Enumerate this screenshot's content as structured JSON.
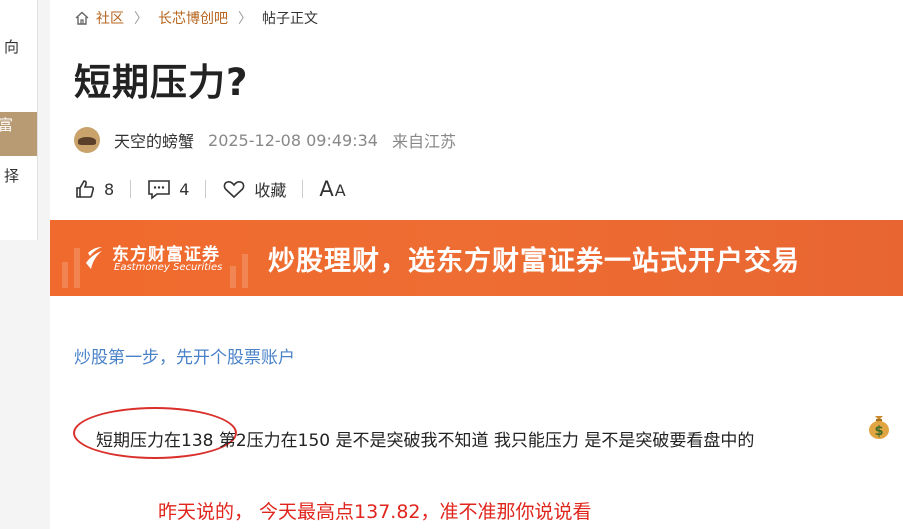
{
  "left_panel": {
    "line1": "向",
    "band": "富",
    "line2": "择"
  },
  "breadcrumb": {
    "home": "社区",
    "forum": "长芯博创吧",
    "current": "帖子正文",
    "separator": "〉"
  },
  "post": {
    "title": "短期压力?",
    "author": "天空的螃蟹",
    "time": "2025-12-08 09:49:34",
    "from": "来自江苏"
  },
  "actions": {
    "likes": "8",
    "comments": "4",
    "favorite_label": "收藏",
    "font_label_big": "A",
    "font_label_small": "A"
  },
  "banner": {
    "brand_cn": "东方财富证券",
    "brand_en": "Eastmoney Securities",
    "slogan": "炒股理财，选东方财富证券一站式开户交易"
  },
  "content": {
    "promo_link": "炒股第一步，先开个股票账户",
    "body": "短期压力在138 第2压力在150 是不是突破我不知道 我只能压力 是不是突破要看盘中的",
    "red_text": "昨天说的， 今天最高点137.82，准不准那你说说看"
  },
  "colors": {
    "accent": "#b7651f",
    "link": "#4a82c8",
    "banner": "#ef6b2f",
    "red": "#e0251c"
  },
  "icons": [
    "home-icon",
    "like-icon",
    "comment-icon",
    "heart-icon",
    "font-size-icon",
    "money-bag-icon",
    "eastmoney-logo-icon"
  ]
}
